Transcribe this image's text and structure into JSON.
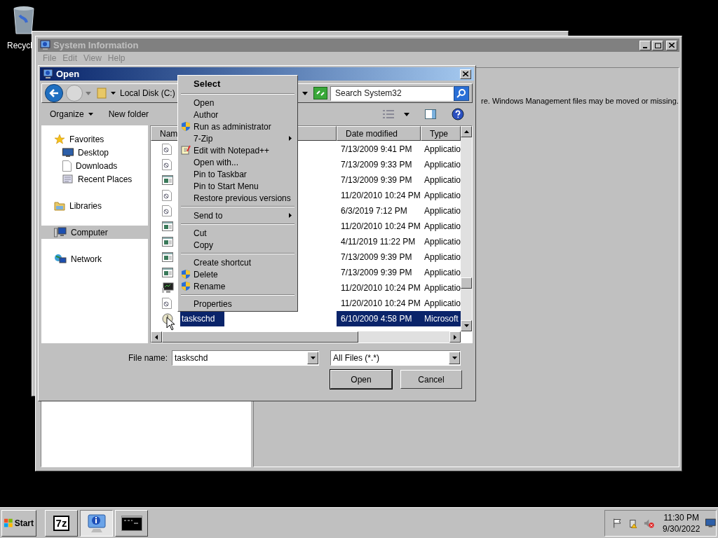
{
  "desktop_icons": [
    {
      "label": "Recycl"
    }
  ],
  "system_information": {
    "title": "System Information",
    "menu": [
      "File",
      "Edit",
      "View",
      "Help"
    ],
    "message": "re. Windows Management files may be moved or missing."
  },
  "open_dialog": {
    "title": "Open",
    "address": "Local Disk (C:)",
    "search": {
      "placeholder": "Search System32"
    },
    "toolbar": [
      "Organize",
      "New folder"
    ],
    "nav": [
      {
        "label": "Favorites",
        "kind": "star",
        "selected": false,
        "children": [
          {
            "label": "Desktop",
            "kind": "desktop",
            "selected": false
          },
          {
            "label": "Downloads",
            "kind": "page",
            "selected": false
          },
          {
            "label": "Recent Places",
            "kind": "recent",
            "selected": false
          }
        ]
      },
      {
        "label": "Libraries",
        "kind": "library",
        "selected": false
      },
      {
        "label": "Computer",
        "kind": "computer",
        "selected": true
      },
      {
        "label": "Network",
        "kind": "network",
        "selected": false
      }
    ],
    "columns": [
      "Nam",
      "Date modified",
      "Type"
    ],
    "rows": [
      {
        "kind": "program",
        "date": "7/13/2009 9:41 PM",
        "type": "Applicatio",
        "selected": false
      },
      {
        "kind": "program",
        "date": "7/13/2009 9:33 PM",
        "type": "Applicatio",
        "selected": false
      },
      {
        "kind": "window",
        "date": "7/13/2009 9:39 PM",
        "type": "Applicatio",
        "selected": false
      },
      {
        "kind": "program",
        "date": "11/20/2010 10:24 PM",
        "type": "Applicatio",
        "selected": false
      },
      {
        "kind": "program",
        "date": "6/3/2019 7:12 PM",
        "type": "Applicatio",
        "selected": false
      },
      {
        "kind": "window",
        "date": "11/20/2010 10:24 PM",
        "type": "Applicatio",
        "selected": false
      },
      {
        "kind": "window",
        "date": "4/11/2019 11:22 PM",
        "type": "Applicatio",
        "selected": false
      },
      {
        "kind": "window",
        "date": "7/13/2009 9:39 PM",
        "type": "Applicatio",
        "selected": false
      },
      {
        "kind": "window",
        "date": "7/13/2009 9:39 PM",
        "type": "Applicatio",
        "selected": false
      },
      {
        "kind": "monitor",
        "date": "11/20/2010 10:24 PM",
        "type": "Applicatio",
        "selected": false
      },
      {
        "kind": "program",
        "date": "11/20/2010 10:24 PM",
        "type": "Applicatio",
        "selected": false
      },
      {
        "kind": "clock",
        "name": "taskschd",
        "date": "6/10/2009 4:58 PM",
        "type": "Microsoft",
        "selected": true
      }
    ],
    "file_name": {
      "label": "File name:",
      "value": "taskschd"
    },
    "file_type": "All Files (*.*)",
    "buttons": [
      "Open",
      "Cancel"
    ]
  },
  "context_menu": {
    "items": [
      {
        "kind": "header",
        "label": "Select"
      },
      {
        "kind": "separator"
      },
      {
        "kind": "plain",
        "label": "Open"
      },
      {
        "kind": "plain",
        "label": "Author"
      },
      {
        "kind": "shield",
        "label": "Run as administrator"
      },
      {
        "kind": "submenu",
        "label": "7-Zip"
      },
      {
        "kind": "notepad",
        "label": "Edit with Notepad++"
      },
      {
        "kind": "plain",
        "label": "Open with..."
      },
      {
        "kind": "plain",
        "label": "Pin to Taskbar"
      },
      {
        "kind": "plain",
        "label": "Pin to Start Menu"
      },
      {
        "kind": "plain",
        "label": "Restore previous versions"
      },
      {
        "kind": "separator"
      },
      {
        "kind": "submenu",
        "label": "Send to"
      },
      {
        "kind": "separator"
      },
      {
        "kind": "plain",
        "label": "Cut"
      },
      {
        "kind": "plain",
        "label": "Copy"
      },
      {
        "kind": "separator"
      },
      {
        "kind": "plain",
        "label": "Create shortcut"
      },
      {
        "kind": "shield",
        "label": "Delete"
      },
      {
        "kind": "shield",
        "label": "Rename"
      },
      {
        "kind": "separator"
      },
      {
        "kind": "plain",
        "label": "Properties"
      }
    ]
  },
  "taskbar": {
    "start": "Start",
    "tasks": [
      {
        "kind": "archiver",
        "label": "7z",
        "selected": false
      },
      {
        "kind": "info",
        "selected": true
      },
      {
        "kind": "console",
        "selected": false
      }
    ],
    "clock": {
      "time": "11:30 PM",
      "date": "9/30/2022"
    }
  }
}
